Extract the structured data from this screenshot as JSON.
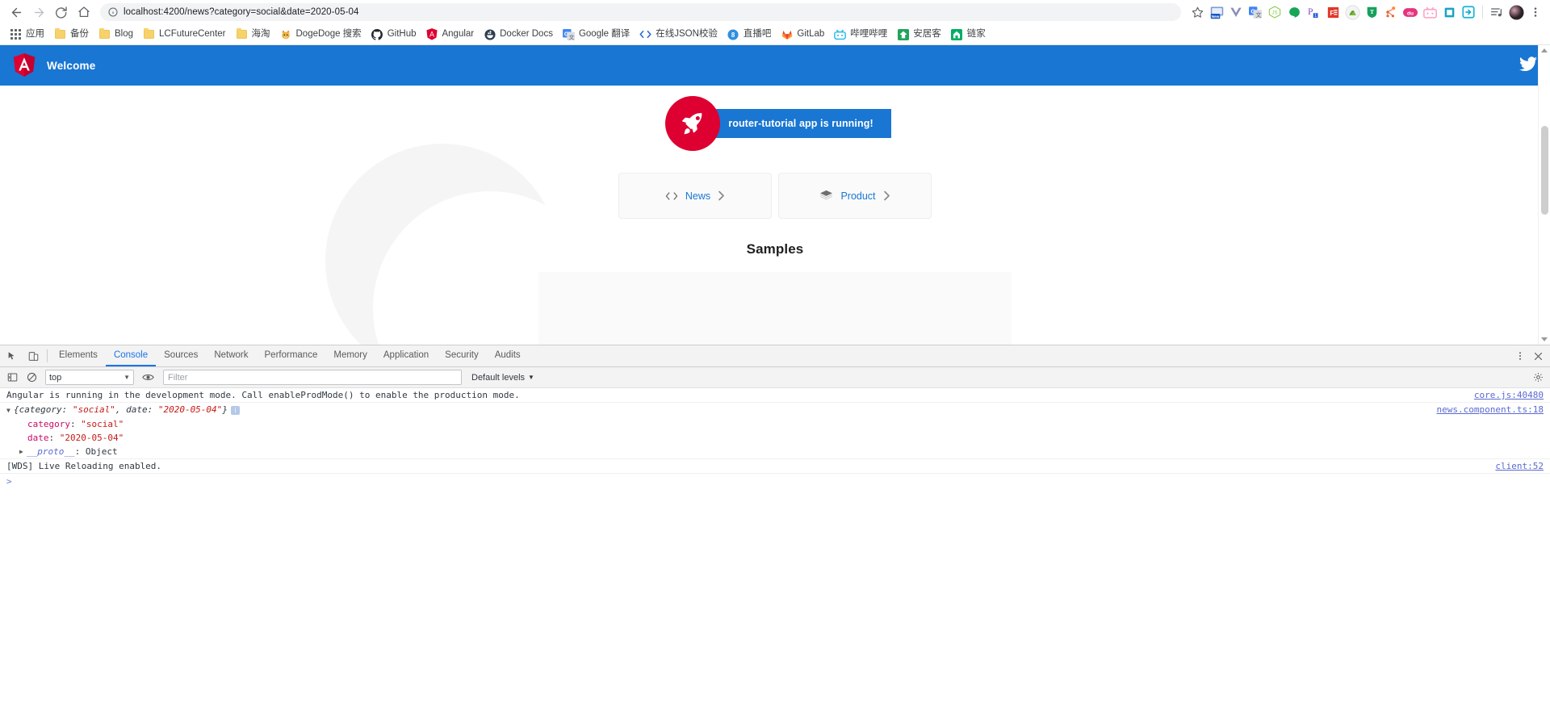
{
  "browser": {
    "url": "localhost:4200/news?category=social&date=2020-05-04",
    "nav": {
      "back": "back-button",
      "forward": "forward-button",
      "reload": "reload-button",
      "home": "home-button"
    },
    "toolbar_icons": [
      {
        "name": "bookmark-star-icon"
      },
      {
        "name": "new-extension-icon",
        "badge": "New"
      },
      {
        "name": "vue-devtools-icon"
      },
      {
        "name": "google-translate-icon"
      },
      {
        "name": "nodejs-icon"
      },
      {
        "name": "green-dot-extension-icon"
      },
      {
        "name": "pdf-extension-icon"
      },
      {
        "name": "powerpoint-extension-icon"
      },
      {
        "name": "red-file-extension-icon"
      },
      {
        "name": "tampermonkey-icon"
      },
      {
        "name": "shield-extension-icon"
      },
      {
        "name": "network-graph-icon"
      },
      {
        "name": "baidu-extension-icon"
      },
      {
        "name": "tv-extension-icon"
      },
      {
        "name": "clipboard-extension-icon"
      },
      {
        "name": "send-to-device-icon"
      },
      {
        "name": "media-playlist-icon"
      },
      {
        "name": "profile-avatar"
      },
      {
        "name": "chrome-menu-icon"
      }
    ],
    "bookmarks": [
      {
        "label": "应用",
        "icon": "apps-grid-icon"
      },
      {
        "label": "备份",
        "icon": "folder-icon"
      },
      {
        "label": "Blog",
        "icon": "folder-icon"
      },
      {
        "label": "LCFutureCenter",
        "icon": "folder-icon"
      },
      {
        "label": "海淘",
        "icon": "folder-icon"
      },
      {
        "label": "DogeDoge 搜索",
        "icon": "doge-icon"
      },
      {
        "label": "GitHub",
        "icon": "github-icon"
      },
      {
        "label": "Angular",
        "icon": "angular-icon"
      },
      {
        "label": "Docker Docs",
        "icon": "docker-icon"
      },
      {
        "label": "Google 翻译",
        "icon": "google-translate-icon"
      },
      {
        "label": "在线JSON校验",
        "icon": "code-brackets-icon"
      },
      {
        "label": "直播吧",
        "icon": "zhibo8-icon"
      },
      {
        "label": "GitLab",
        "icon": "gitlab-icon"
      },
      {
        "label": "哔哩哔哩",
        "icon": "bilibili-icon"
      },
      {
        "label": "安居客",
        "icon": "anjuke-icon"
      },
      {
        "label": "链家",
        "icon": "lianjia-icon"
      }
    ]
  },
  "app": {
    "toolbar_title": "Welcome",
    "logo_name": "angular-logo",
    "twitter_icon": "twitter-icon",
    "banner_text": "router-tutorial app is running!",
    "rocket_icon": "rocket-icon",
    "cards": [
      {
        "label": "News",
        "left_icon": "code-brackets-icon",
        "right_icon": "chevron-right-icon"
      },
      {
        "label": "Product",
        "left_icon": "layers-icon",
        "right_icon": "chevron-right-icon"
      }
    ],
    "samples_heading": "Samples"
  },
  "devtools": {
    "left_buttons": [
      {
        "name": "inspect-element-icon"
      },
      {
        "name": "toggle-device-toolbar-icon"
      }
    ],
    "tabs": [
      {
        "label": "Elements",
        "active": false
      },
      {
        "label": "Console",
        "active": true
      },
      {
        "label": "Sources",
        "active": false
      },
      {
        "label": "Network",
        "active": false
      },
      {
        "label": "Performance",
        "active": false
      },
      {
        "label": "Memory",
        "active": false
      },
      {
        "label": "Application",
        "active": false
      },
      {
        "label": "Security",
        "active": false
      },
      {
        "label": "Audits",
        "active": false
      }
    ],
    "more_icon": "devtools-kebab-icon",
    "close_icon": "close-devtools-icon",
    "console_toolbar": {
      "clear_icon": "clear-console-icon",
      "sidebar_icon": "console-sidebar-icon",
      "eye_icon": "live-expression-icon",
      "context": "top",
      "filter_placeholder": "Filter",
      "levels_label": "Default levels",
      "settings_icon": "console-settings-icon"
    },
    "console_rows": [
      {
        "type": "text",
        "text": "Angular is running in the development mode. Call enableProdMode() to enable the production mode.",
        "source": "core.js:40480"
      },
      {
        "type": "object",
        "preview_open": "{category: ",
        "preview_val1": "\"social\"",
        "preview_mid": ", date: ",
        "preview_val2": "\"2020-05-04\"",
        "preview_close": "}",
        "source": "news.component.ts:18",
        "props": [
          {
            "key": "category",
            "value": "\"social\""
          },
          {
            "key": "date",
            "value": "\"2020-05-04\""
          }
        ],
        "proto_key": "__proto__",
        "proto_value": "Object"
      },
      {
        "type": "text",
        "text": "[WDS] Live Reloading enabled.",
        "source": "client:52"
      }
    ],
    "prompt": ">"
  },
  "colors": {
    "angular_blue": "#1976d2",
    "angular_red": "#dd0031",
    "devtools_active": "#1a73e8"
  }
}
